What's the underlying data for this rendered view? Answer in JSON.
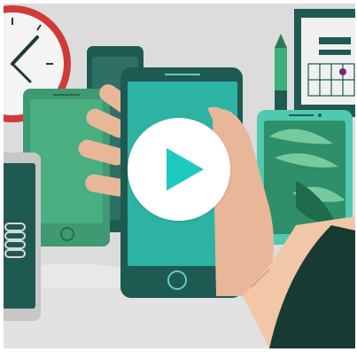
{
  "video": {
    "play_button_icon": "play-icon",
    "accent_color": "#1ec9c0",
    "background_color": "#dcdcdc"
  }
}
